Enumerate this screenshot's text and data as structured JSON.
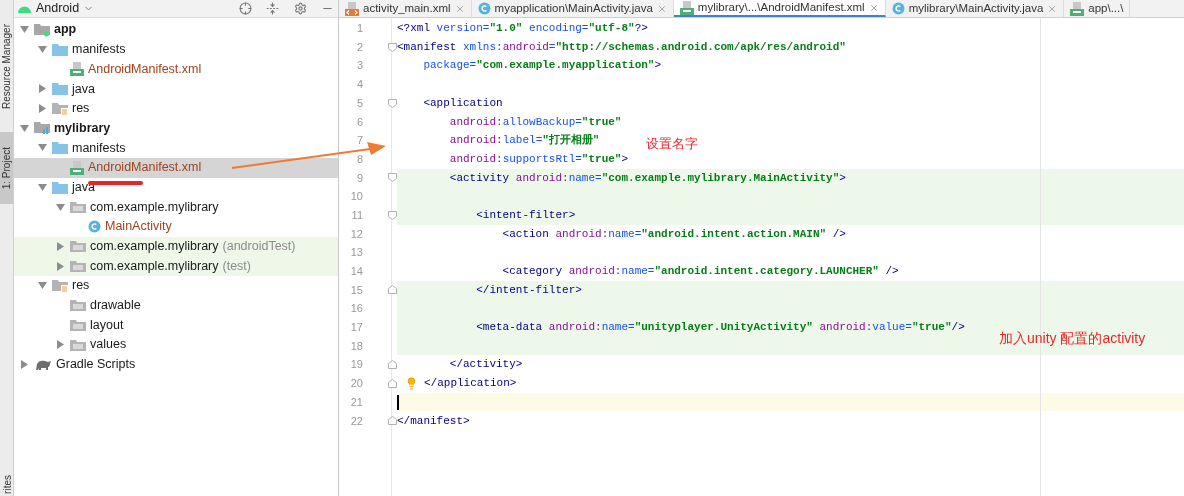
{
  "side_strip": {
    "tabs": [
      {
        "label": "Resource Manager",
        "selected": false
      },
      {
        "label": "1: Project",
        "selected": true
      }
    ],
    "bottom_label": "rites"
  },
  "project_panel": {
    "view_selector": "Android",
    "tree": [
      {
        "label": "app",
        "kind": "module",
        "expanded": true,
        "selected": false,
        "children": [
          {
            "label": "manifests",
            "kind": "folder",
            "expanded": true,
            "selected": false,
            "children": [
              {
                "label": "AndroidManifest.xml",
                "kind": "manifest",
                "selected": false
              }
            ]
          },
          {
            "label": "java",
            "kind": "folder",
            "expanded": false,
            "selected": false
          },
          {
            "label": "res",
            "kind": "res",
            "expanded": false,
            "selected": false
          }
        ]
      },
      {
        "label": "mylibrary",
        "kind": "library",
        "expanded": true,
        "selected": false,
        "children": [
          {
            "label": "manifests",
            "kind": "folder",
            "expanded": true,
            "selected": false,
            "children": [
              {
                "label": "AndroidManifest.xml",
                "kind": "manifest",
                "selected": true
              }
            ]
          },
          {
            "label": "java",
            "kind": "folder",
            "expanded": true,
            "selected": false,
            "children": [
              {
                "label": "com.example.mylibrary",
                "kind": "package",
                "expanded": true,
                "selected": false,
                "children": [
                  {
                    "label": "MainActivity",
                    "kind": "class",
                    "selected": false
                  }
                ]
              },
              {
                "label": "com.example.mylibrary",
                "suffix": "(androidTest)",
                "kind": "test-package",
                "expanded": false,
                "selected": false
              },
              {
                "label": "com.example.mylibrary",
                "suffix": "(test)",
                "kind": "test-package",
                "expanded": false,
                "selected": false
              }
            ]
          },
          {
            "label": "res",
            "kind": "res",
            "expanded": true,
            "selected": false,
            "children": [
              {
                "label": "drawable",
                "kind": "package",
                "selected": false
              },
              {
                "label": "layout",
                "kind": "package",
                "selected": false
              },
              {
                "label": "values",
                "kind": "package",
                "expanded": false,
                "selected": false
              }
            ]
          }
        ]
      },
      {
        "label": "Gradle Scripts",
        "kind": "gradle",
        "expanded": false,
        "selected": false
      }
    ]
  },
  "editor": {
    "tabs": [
      {
        "label": "activity_main.xml",
        "kind": "xml",
        "selected": false,
        "closable": true
      },
      {
        "label": "myapplication\\MainActivity.java",
        "kind": "class",
        "selected": false,
        "closable": true
      },
      {
        "label": "mylibrary\\...\\AndroidManifest.xml",
        "kind": "manifest",
        "selected": true,
        "closable": true
      },
      {
        "label": "mylibrary\\MainActivity.java",
        "kind": "class",
        "selected": false,
        "closable": true
      },
      {
        "label": "app\\...\\",
        "kind": "manifest",
        "selected": false,
        "closable": false
      }
    ],
    "lines": [
      {
        "number": "1",
        "kind": "plain",
        "tokens": [
          {
            "kind": "tag",
            "text": "<?xml "
          },
          {
            "kind": "attr",
            "text": "version="
          },
          {
            "kind": "value",
            "text": "\"1.0\" "
          },
          {
            "kind": "attr",
            "text": "encoding="
          },
          {
            "kind": "value",
            "text": "\"utf-8\""
          },
          {
            "kind": "tag",
            "text": "?>"
          }
        ]
      },
      {
        "number": "2",
        "kind": "plain",
        "fold_start": true,
        "tokens": [
          {
            "kind": "tag",
            "text": "<manifest "
          },
          {
            "kind": "attr",
            "text": "xmlns:"
          },
          {
            "kind": "ns",
            "text": "android"
          },
          {
            "kind": "attr",
            "text": "="
          },
          {
            "kind": "value",
            "text": "\"http://schemas.android.com/apk/res/android\""
          }
        ]
      },
      {
        "number": "3",
        "kind": "plain",
        "tokens": [
          {
            "kind": "attr",
            "text": "    package="
          },
          {
            "kind": "value",
            "text": "\"com.example.myapplication\""
          },
          {
            "kind": "tag",
            "text": ">"
          }
        ]
      },
      {
        "number": "4",
        "kind": "plain"
      },
      {
        "number": "5",
        "kind": "plain",
        "fold_start": true,
        "tokens": [
          {
            "kind": "tag",
            "text": "    <application"
          }
        ]
      },
      {
        "number": "6",
        "kind": "plain",
        "tokens": [
          {
            "kind": "ns",
            "text": "        android:"
          },
          {
            "kind": "attr",
            "text": "allowBackup="
          },
          {
            "kind": "value",
            "text": "\"true\""
          }
        ]
      },
      {
        "number": "7",
        "kind": "plain",
        "tokens": [
          {
            "kind": "ns",
            "text": "        android:"
          },
          {
            "kind": "attr",
            "text": "label="
          },
          {
            "kind": "value",
            "text": "\"打开相册\""
          }
        ]
      },
      {
        "number": "8",
        "kind": "plain",
        "tokens": [
          {
            "kind": "ns",
            "text": "        android:"
          },
          {
            "kind": "attr",
            "text": "supportsRtl="
          },
          {
            "kind": "value",
            "text": "\"true\""
          },
          {
            "kind": "tag",
            "text": ">"
          }
        ]
      },
      {
        "number": "9",
        "kind": "changed",
        "fold_start": true,
        "tokens": [
          {
            "kind": "tag",
            "text": "        <activity "
          },
          {
            "kind": "ns",
            "text": "android:"
          },
          {
            "kind": "attr",
            "text": "name="
          },
          {
            "kind": "value",
            "text": "\"com.example.mylibrary.MainActivity\""
          },
          {
            "kind": "tag",
            "text": ">"
          }
        ]
      },
      {
        "number": "10",
        "kind": "changed"
      },
      {
        "number": "11",
        "kind": "changed",
        "fold_start": true,
        "tokens": [
          {
            "kind": "tag",
            "text": "            <intent-filter>"
          }
        ]
      },
      {
        "number": "12",
        "kind": "plain",
        "tokens": [
          {
            "kind": "tag",
            "text": "                <action "
          },
          {
            "kind": "ns",
            "text": "android:"
          },
          {
            "kind": "attr",
            "text": "name="
          },
          {
            "kind": "value",
            "text": "\"android.intent.action.MAIN\" "
          },
          {
            "kind": "tag",
            "text": "/>"
          }
        ]
      },
      {
        "number": "13",
        "kind": "plain"
      },
      {
        "number": "14",
        "kind": "plain",
        "tokens": [
          {
            "kind": "tag",
            "text": "                <category "
          },
          {
            "kind": "ns",
            "text": "android:"
          },
          {
            "kind": "attr",
            "text": "name="
          },
          {
            "kind": "value",
            "text": "\"android.intent.category.LAUNCHER\" "
          },
          {
            "kind": "tag",
            "text": "/>"
          }
        ]
      },
      {
        "number": "15",
        "kind": "changed",
        "fold_end": true,
        "tokens": [
          {
            "kind": "tag",
            "text": "            </intent-filter>"
          }
        ]
      },
      {
        "number": "16",
        "kind": "changed"
      },
      {
        "number": "17",
        "kind": "changed",
        "tokens": [
          {
            "kind": "tag",
            "text": "            <meta-data "
          },
          {
            "kind": "ns",
            "text": "android:"
          },
          {
            "kind": "attr",
            "text": "name="
          },
          {
            "kind": "value",
            "text": "\"unityplayer.UnityActivity\" "
          },
          {
            "kind": "ns",
            "text": "android:"
          },
          {
            "kind": "attr",
            "text": "value="
          },
          {
            "kind": "value",
            "text": "\"true\""
          },
          {
            "kind": "tag",
            "text": "/>"
          }
        ]
      },
      {
        "number": "18",
        "kind": "changed"
      },
      {
        "number": "19",
        "kind": "plain",
        "fold_end": true,
        "tokens": [
          {
            "kind": "tag",
            "text": "        </activity>"
          }
        ]
      },
      {
        "number": "20",
        "kind": "plain",
        "fold_end": true,
        "bulb": true,
        "tokens": [
          {
            "kind": "tag",
            "text": "</application>"
          }
        ]
      },
      {
        "number": "21",
        "kind": "current"
      },
      {
        "number": "22",
        "kind": "plain",
        "fold_end": true,
        "tokens": [
          {
            "kind": "tag",
            "text": "</manifest>"
          }
        ]
      }
    ]
  },
  "annotations": [
    {
      "text": "设置名字"
    },
    {
      "text": "加入unity 配置的activity"
    }
  ]
}
